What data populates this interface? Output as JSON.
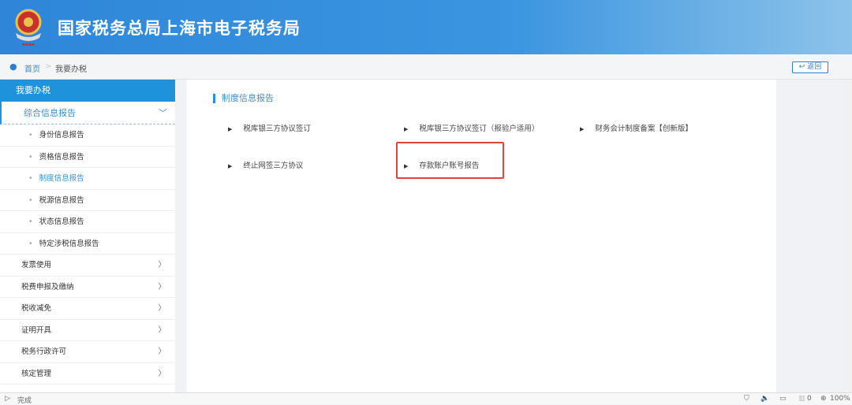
{
  "header": {
    "title": "国家税务总局上海市电子税务局"
  },
  "breadcrumb": {
    "home": "首页",
    "separator": ">",
    "current": "我要办税",
    "back": "返回"
  },
  "sidebar": {
    "head": "我要办税",
    "group": "综合信息报告",
    "subs": [
      "身份信息报告",
      "资格信息报告",
      "制度信息报告",
      "税源信息报告",
      "状态信息报告",
      "特定涉税信息报告"
    ],
    "active_index": 2,
    "items": [
      "发票使用",
      "税费申报及缴纳",
      "税收减免",
      "证明开具",
      "税务行政许可",
      "核定管理"
    ]
  },
  "main": {
    "section_title": "制度信息报告",
    "links": [
      "税库银三方协议签订",
      "税库银三方协议签订（报验户适用）",
      "财务会计制度备案【创新版】",
      "终止网签三方协议",
      "存款账户账号报告"
    ]
  },
  "status": {
    "text": "完成",
    "badge_count": "0",
    "zoom": "100%"
  },
  "colors": {
    "accent": "#1e93db",
    "highlight": "#e0443c"
  }
}
